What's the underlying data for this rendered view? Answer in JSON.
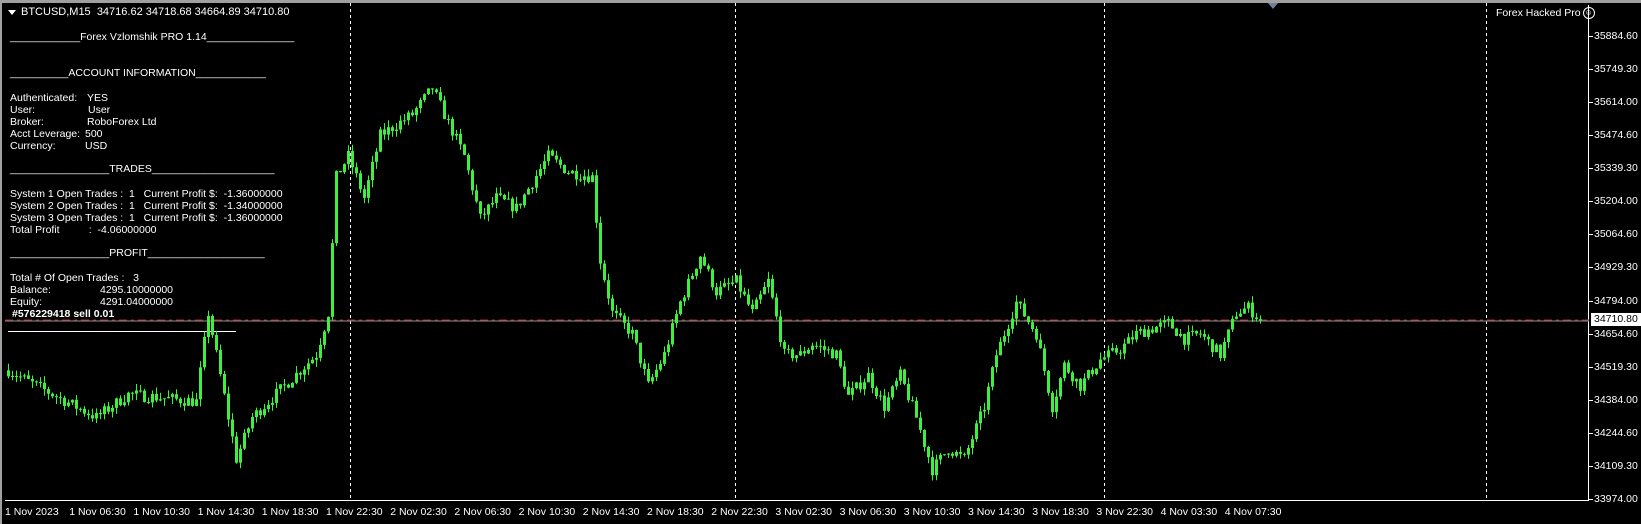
{
  "header": {
    "symbol": "BTCUSD,M15",
    "ohlc": "34716.62 34718.68 34664.89 34710.80"
  },
  "brand": {
    "label": "Forex Hacked Pro",
    "icon": "smiley-icon"
  },
  "panel": {
    "title": "____________Forex Vzlomshik PRO 1.14_______________",
    "account_header": "__________ACCOUNT INFORMATION____________",
    "account": [
      {
        "label": "Authenticated:",
        "value": "YES"
      },
      {
        "label": "User:",
        "value": "User"
      },
      {
        "label": "Broker:",
        "value": "RoboForex Ltd"
      },
      {
        "label": "Acct Leverage:",
        "value": "500"
      },
      {
        "label": "Currency:",
        "value": "USD"
      }
    ],
    "trades_header": "_________________TRADES_____________________",
    "trades": [
      "System 1 Open Trades :  1   Current Profit $:  -1.36000000",
      "System 2 Open Trades :  1   Current Profit $:  -1.34000000",
      "System 3 Open Trades :  1   Current Profit $:  -1.36000000",
      "Total Profit          :  -4.06000000"
    ],
    "profit_header": "_________________PROFIT____________________",
    "open_trades": "Total # Of Open Trades :   3",
    "balance_label": "Balance:",
    "balance": "4295.10000000",
    "equity_label": "Equity:",
    "equity": "4291.04000000",
    "order": "#576229418 sell 0.01"
  },
  "price_axis": [
    "35884.60",
    "35749.30",
    "35614.00",
    "35474.60",
    "35339.30",
    "35204.00",
    "35064.60",
    "34929.30",
    "34794.00",
    "34654.60",
    "34519.30",
    "34384.00",
    "34244.60",
    "34109.30",
    "33974.00"
  ],
  "current_price": "34710.80",
  "time_axis": [
    "1 Nov 2023",
    "1 Nov 06:30",
    "1 Nov 10:30",
    "1 Nov 14:30",
    "1 Nov 18:30",
    "1 Nov 22:30",
    "2 Nov 02:30",
    "2 Nov 06:30",
    "2 Nov 10:30",
    "2 Nov 14:30",
    "2 Nov 18:30",
    "2 Nov 22:30",
    "3 Nov 02:30",
    "3 Nov 06:30",
    "3 Nov 10:30",
    "3 Nov 14:30",
    "3 Nov 18:30",
    "3 Nov 22:30",
    "4 Nov 03:30",
    "4 Nov 07:30"
  ],
  "colors": {
    "candle": "#3cf03c",
    "price_line": "#c0202a",
    "grid": "#ffffff"
  },
  "chart": {
    "type": "candlestick",
    "ylim": [
      33974.0,
      35884.6
    ],
    "candle_count": 314,
    "price_path": [
      [
        0,
        34505
      ],
      [
        7,
        34441
      ],
      [
        22,
        34311
      ],
      [
        30,
        34406
      ],
      [
        47,
        34376
      ],
      [
        50,
        34742
      ],
      [
        52,
        34570
      ],
      [
        57,
        34139
      ],
      [
        61,
        34311
      ],
      [
        77,
        34570
      ],
      [
        80,
        34742
      ],
      [
        82,
        35303
      ],
      [
        85,
        35389
      ],
      [
        89,
        35217
      ],
      [
        93,
        35475
      ],
      [
        101,
        35561
      ],
      [
        106,
        35669
      ],
      [
        109,
        35561
      ],
      [
        114,
        35389
      ],
      [
        118,
        35131
      ],
      [
        122,
        35217
      ],
      [
        127,
        35174
      ],
      [
        135,
        35389
      ],
      [
        140,
        35325
      ],
      [
        146,
        35303
      ],
      [
        148,
        34958
      ],
      [
        151,
        34742
      ],
      [
        156,
        34656
      ],
      [
        160,
        34441
      ],
      [
        164,
        34570
      ],
      [
        168,
        34786
      ],
      [
        173,
        34980
      ],
      [
        177,
        34829
      ],
      [
        182,
        34872
      ],
      [
        186,
        34742
      ],
      [
        190,
        34872
      ],
      [
        194,
        34570
      ],
      [
        198,
        34570
      ],
      [
        201,
        34613
      ],
      [
        207,
        34570
      ],
      [
        210,
        34398
      ],
      [
        215,
        34484
      ],
      [
        219,
        34355
      ],
      [
        223,
        34484
      ],
      [
        227,
        34311
      ],
      [
        231,
        34096
      ],
      [
        235,
        34182
      ],
      [
        239,
        34139
      ],
      [
        244,
        34355
      ],
      [
        247,
        34570
      ],
      [
        252,
        34786
      ],
      [
        257,
        34656
      ],
      [
        261,
        34355
      ],
      [
        264,
        34527
      ],
      [
        268,
        34441
      ],
      [
        273,
        34549
      ],
      [
        278,
        34592
      ],
      [
        282,
        34656
      ],
      [
        290,
        34700
      ],
      [
        294,
        34635
      ],
      [
        298,
        34656
      ],
      [
        303,
        34570
      ],
      [
        307,
        34742
      ],
      [
        310,
        34764
      ],
      [
        313,
        34710.8
      ]
    ]
  }
}
